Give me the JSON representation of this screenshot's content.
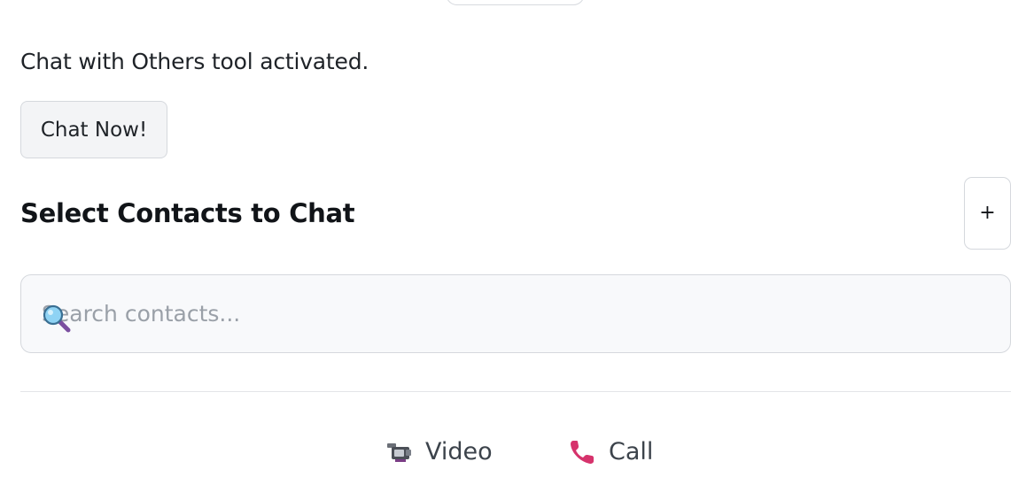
{
  "status": {
    "text": "Chat with Others tool activated."
  },
  "chat_now": {
    "label": "Chat Now!"
  },
  "contacts": {
    "title": "Select Contacts to Chat",
    "add_label": "+",
    "search_placeholder": "Search contacts..."
  },
  "actions": [
    {
      "label": "Video",
      "icon": "video-camera-icon"
    },
    {
      "label": "Call",
      "icon": "telephone-receiver-icon"
    }
  ]
}
